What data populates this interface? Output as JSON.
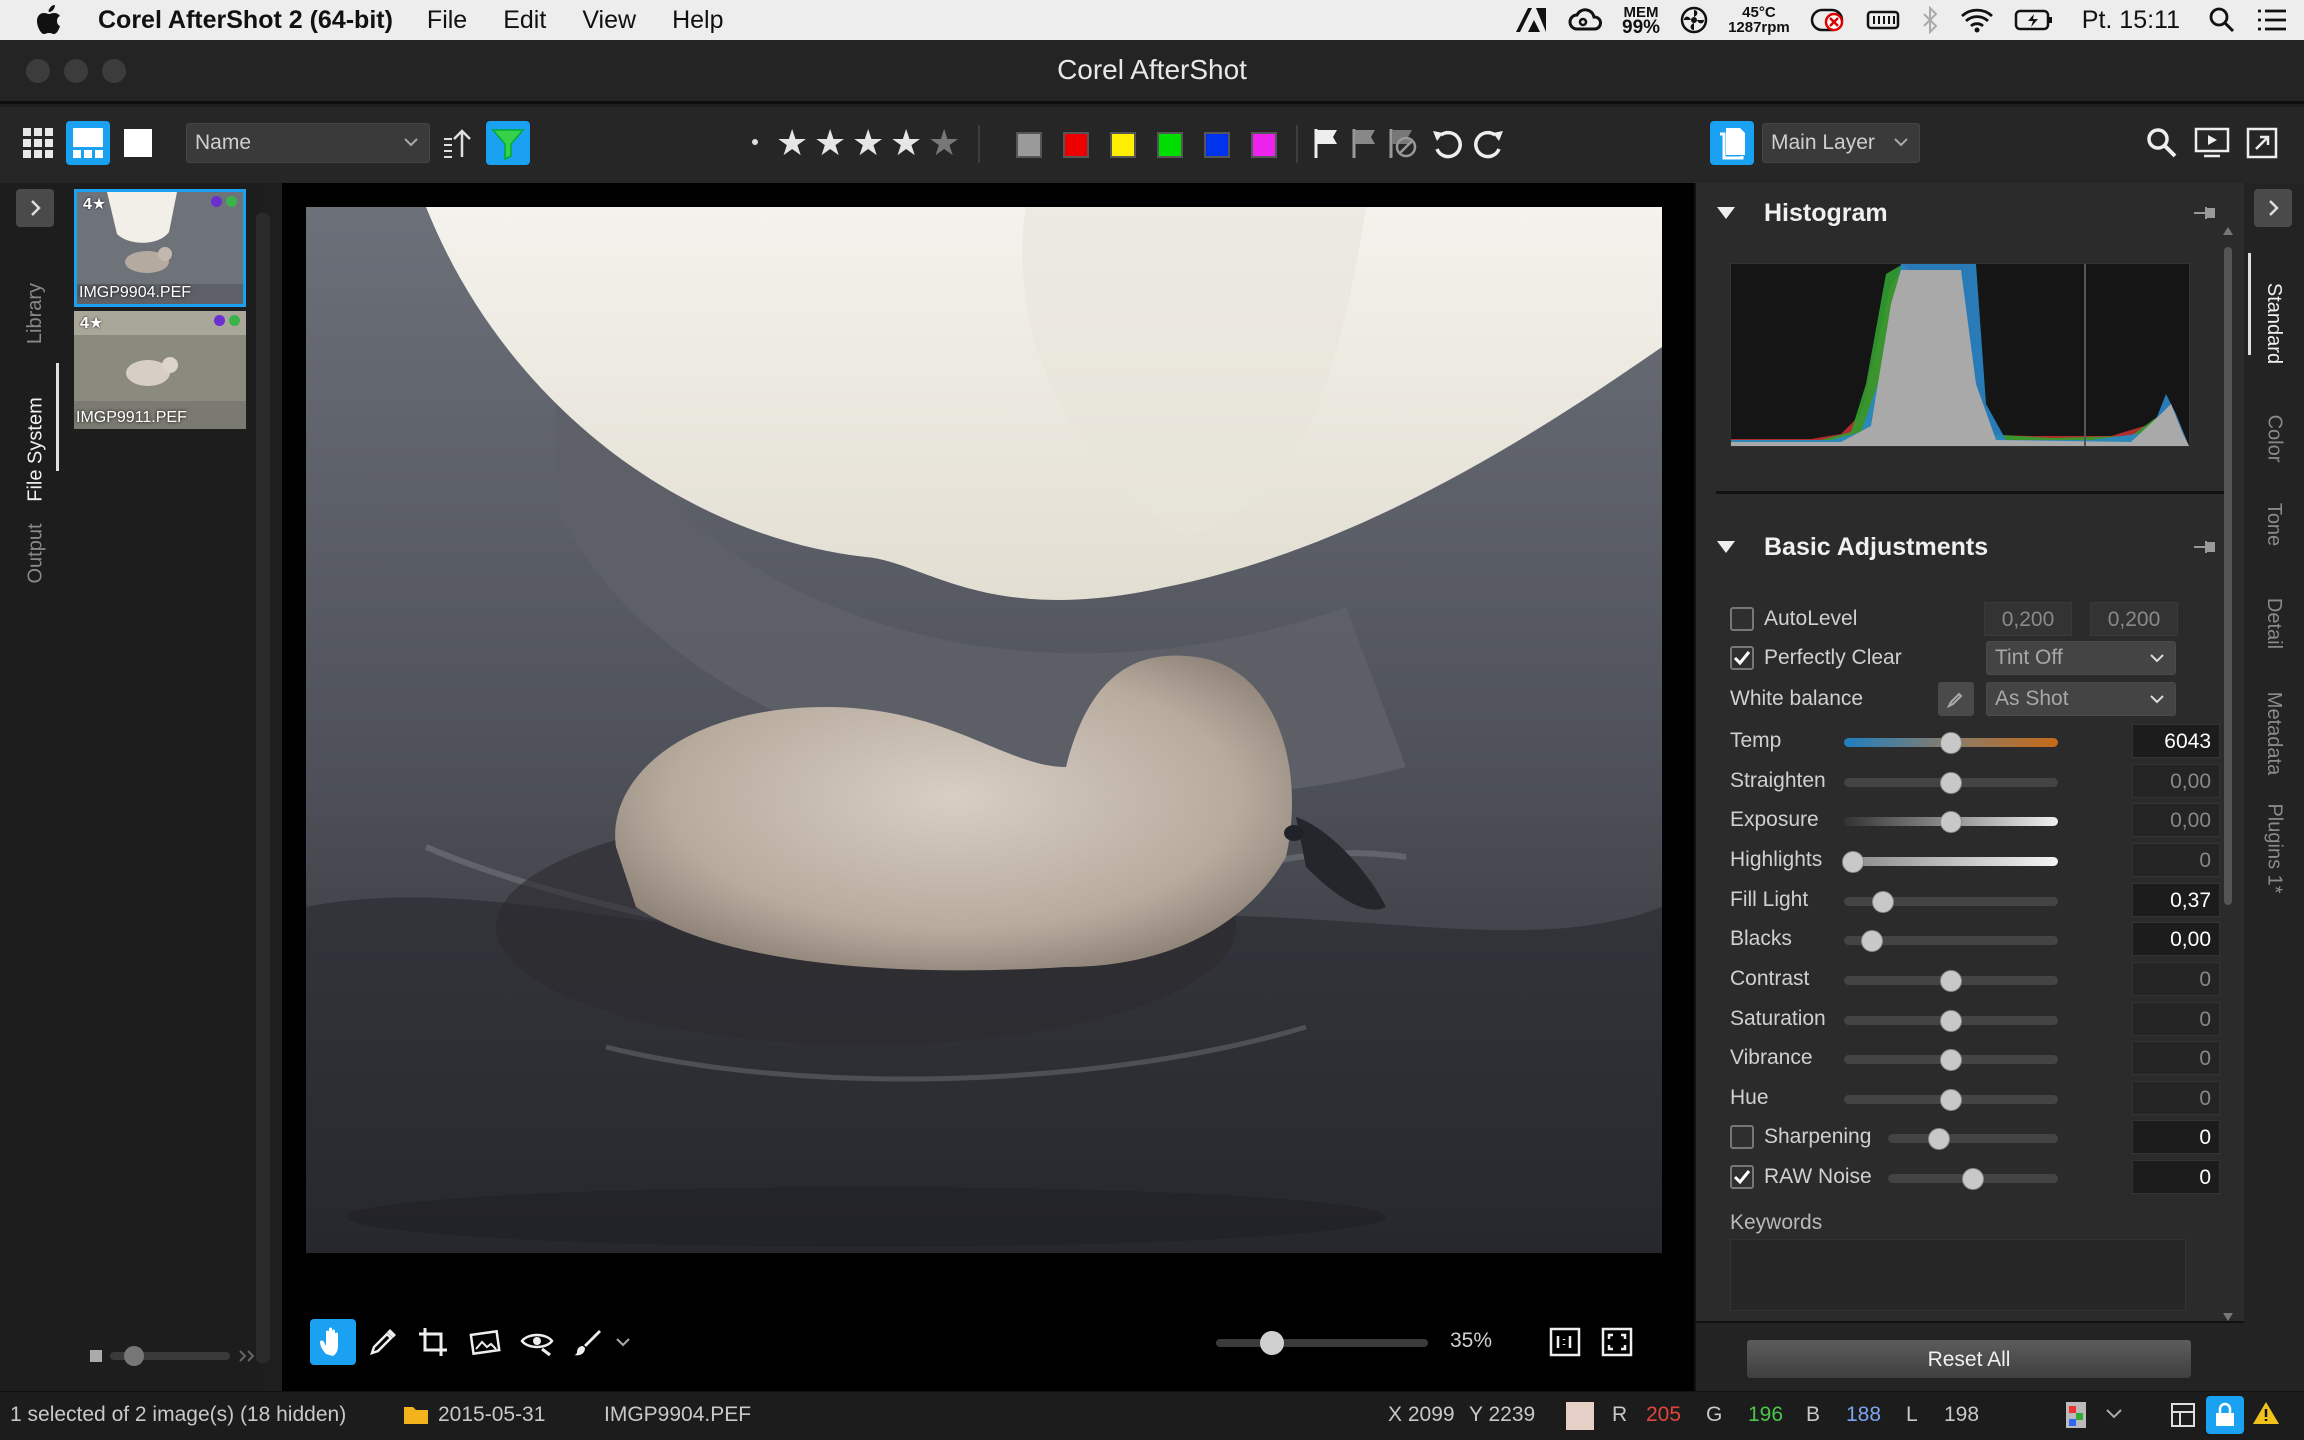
{
  "menubar": {
    "app_name": "Corel AfterShot 2 (64-bit)",
    "menus": [
      "File",
      "Edit",
      "View",
      "Help"
    ],
    "status": {
      "mem_label": "MEM",
      "mem_value": "99%",
      "temp": "45°C",
      "fan": "1287rpm",
      "clock": "Pt. 15:11"
    }
  },
  "window": {
    "title": "Corel AfterShot"
  },
  "toolbar": {
    "sort_label": "Name",
    "layer_label": "Main Layer",
    "swatch_colors": [
      "#9a9a9a",
      "#ee0000",
      "#ffee00",
      "#00dd00",
      "#0033ee",
      "#ee22ee"
    ],
    "accent": "#1aa1f2",
    "stars_filled": 4,
    "stars_total": 5
  },
  "left_tabs": {
    "library": "Library",
    "file_system": "File System",
    "output": "Output"
  },
  "thumbnails": [
    {
      "rating": "4★",
      "filename": "IMGP9904.PEF",
      "selected": true
    },
    {
      "rating": "4★",
      "filename": "IMGP9911.PEF",
      "selected": false
    }
  ],
  "viewer": {
    "zoom": "35%"
  },
  "panels": {
    "histogram_title": "Histogram",
    "basic_title": "Basic Adjustments",
    "autolevel": {
      "label": "AutoLevel",
      "v1": "0,200",
      "v2": "0,200"
    },
    "perfectly_clear": {
      "label": "Perfectly Clear",
      "option": "Tint Off"
    },
    "white_balance": {
      "label": "White balance",
      "option": "As Shot"
    },
    "temp": {
      "label": "Temp",
      "value": "6043",
      "level": 0.5
    },
    "straighten": {
      "label": "Straighten",
      "value": "0,00",
      "level": 0.5
    },
    "exposure": {
      "label": "Exposure",
      "value": "0,00",
      "level": 0.5
    },
    "highlights": {
      "label": "Highlights",
      "value": "0",
      "level": 0.04
    },
    "fill_light": {
      "label": "Fill Light",
      "value": "0,37",
      "level": 0.18
    },
    "blacks": {
      "label": "Blacks",
      "value": "0,00",
      "level": 0.13
    },
    "contrast": {
      "label": "Contrast",
      "value": "0",
      "level": 0.5
    },
    "saturation": {
      "label": "Saturation",
      "value": "0",
      "level": 0.5
    },
    "vibrance": {
      "label": "Vibrance",
      "value": "0",
      "level": 0.5
    },
    "hue": {
      "label": "Hue",
      "value": "0",
      "level": 0.5
    },
    "sharpening": {
      "label": "Sharpening",
      "value": "0",
      "level": 0.3
    },
    "raw_noise": {
      "label": "RAW Noise",
      "value": "0",
      "level": 0.5
    },
    "keywords_label": "Keywords",
    "reset_label": "Reset All"
  },
  "right_tabs": [
    "Standard",
    "Color",
    "Tone",
    "Detail",
    "Metadata",
    "Plugins 1*"
  ],
  "statusbar": {
    "selection": "1 selected of 2 image(s) (18 hidden)",
    "folder": "2015-05-31",
    "file": "IMGP9904.PEF",
    "x": "X 2099",
    "y": "Y 2239",
    "r_label": "R",
    "r_value": "205",
    "g_label": "G",
    "g_value": "196",
    "b_label": "B",
    "b_value": "188",
    "l_label": "L",
    "l_value": "198",
    "sample_color": "#e6cfc7"
  }
}
